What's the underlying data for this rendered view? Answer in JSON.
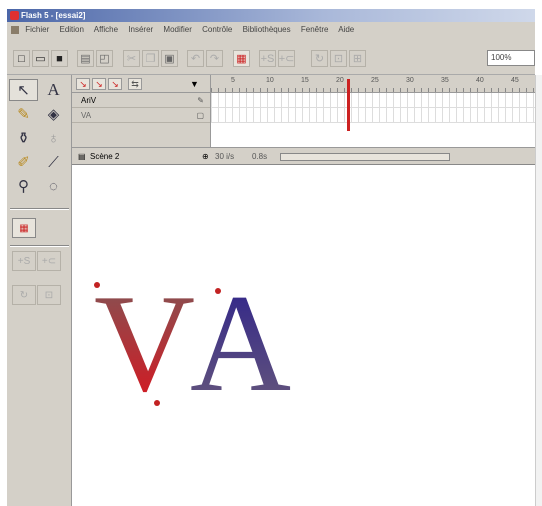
{
  "window": {
    "title": "Flash 5 - [essai2]"
  },
  "menu": [
    "Fichier",
    "Edition",
    "Affiche",
    "Insérer",
    "Modifier",
    "Contrôle",
    "Bibliothèques",
    "Fenêtre",
    "Aide"
  ],
  "toolbar": {
    "buttons": [
      "new-icon",
      "open-icon",
      "save-icon",
      "print-icon",
      "print-preview-icon",
      "cut-icon",
      "copy-icon",
      "paste-icon",
      "undo-icon",
      "redo-icon",
      "snap-icon",
      "smooth-icon",
      "straighten-icon",
      "rotate-icon",
      "scale-icon",
      "align-icon"
    ],
    "zoom": "100%"
  },
  "tools": [
    "arrow-icon",
    "text-icon",
    "pencil-icon",
    "paint-bucket-icon",
    "ink-bottle-icon",
    "lasso-icon",
    "brush-icon",
    "eyedropper-icon",
    "magnifier-icon",
    "lasso-alt-icon"
  ],
  "timeline": {
    "layers": [
      {
        "name": "AriV"
      },
      {
        "name": "VA"
      }
    ],
    "ruler_numbers": [
      "5",
      "10",
      "15",
      "20",
      "25",
      "30",
      "35",
      "40",
      "45"
    ]
  },
  "scene": {
    "label": "Scène 2",
    "fps": "30 i/s",
    "time": "0.8s"
  },
  "stage": {
    "text_v": "V",
    "text_a": "A"
  },
  "colors": {
    "accent": "#c22222",
    "letter_v_top": "#8a5a4a",
    "letter_a": "#3a3a8a"
  }
}
